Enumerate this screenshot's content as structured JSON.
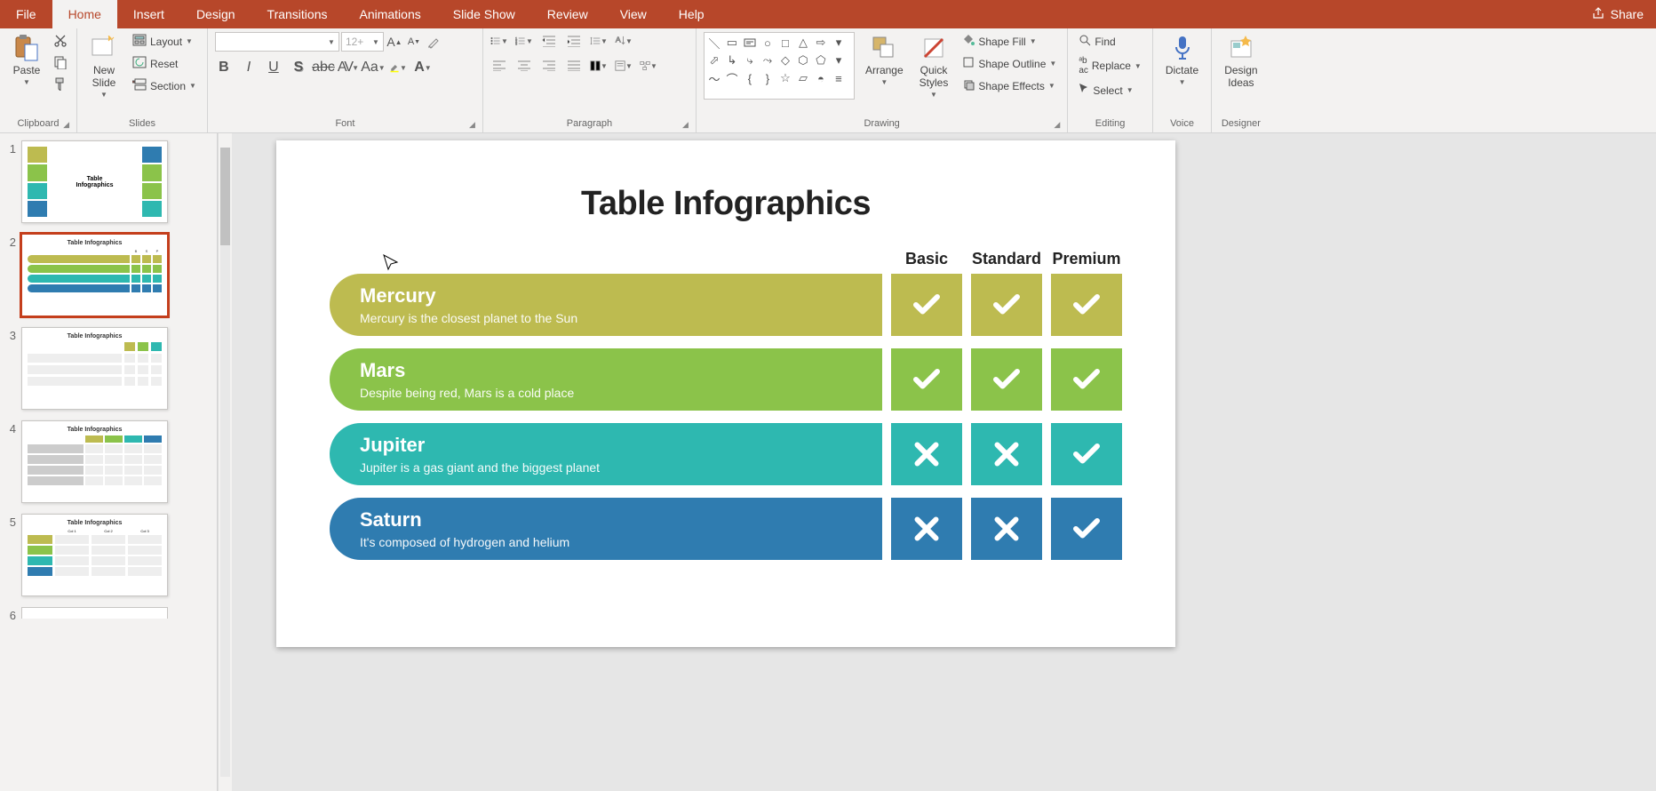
{
  "tabs": {
    "file": "File",
    "home": "Home",
    "insert": "Insert",
    "design": "Design",
    "transitions": "Transitions",
    "animations": "Animations",
    "slideshow": "Slide Show",
    "review": "Review",
    "view": "View",
    "help": "Help"
  },
  "share": "Share",
  "ribbon": {
    "clipboard": {
      "label": "Clipboard",
      "paste": "Paste"
    },
    "slides": {
      "label": "Slides",
      "new": "New\nSlide",
      "layout": "Layout",
      "reset": "Reset",
      "section": "Section"
    },
    "font": {
      "label": "Font",
      "size_placeholder": "12+"
    },
    "paragraph": {
      "label": "Paragraph"
    },
    "drawing": {
      "label": "Drawing",
      "arrange": "Arrange",
      "quick": "Quick\nStyles",
      "fill": "Shape Fill",
      "outline": "Shape Outline",
      "effects": "Shape Effects"
    },
    "editing": {
      "label": "Editing",
      "find": "Find",
      "replace": "Replace",
      "select": "Select"
    },
    "voice": {
      "label": "Voice",
      "dictate": "Dictate"
    },
    "designer": {
      "label": "Designer",
      "ideas": "Design\nIdeas"
    }
  },
  "slide": {
    "title": "Table Infographics",
    "columns": [
      "Basic",
      "Standard",
      "Premium"
    ],
    "rows": [
      {
        "title": "Mercury",
        "sub": "Mercury is the closest planet to the Sun",
        "color": "c-olive",
        "cells": [
          "check",
          "check",
          "check"
        ]
      },
      {
        "title": "Mars",
        "sub": "Despite being red, Mars is a cold place",
        "color": "c-green",
        "cells": [
          "check",
          "check",
          "check"
        ]
      },
      {
        "title": "Jupiter",
        "sub": "Jupiter is a gas giant and the biggest planet",
        "color": "c-teal",
        "cells": [
          "cross",
          "cross",
          "check"
        ]
      },
      {
        "title": "Saturn",
        "sub": "It's composed of hydrogen and helium",
        "color": "c-blue",
        "cells": [
          "cross",
          "cross",
          "check"
        ]
      }
    ]
  },
  "thumbs": [
    {
      "n": "1",
      "title": "Table\nInfographics"
    },
    {
      "n": "2",
      "title": "Table Infographics",
      "active": true
    },
    {
      "n": "3",
      "title": "Table Infographics"
    },
    {
      "n": "4",
      "title": "Table Infographics"
    },
    {
      "n": "5",
      "title": "Table Infographics"
    },
    {
      "n": "6",
      "title": ""
    }
  ]
}
